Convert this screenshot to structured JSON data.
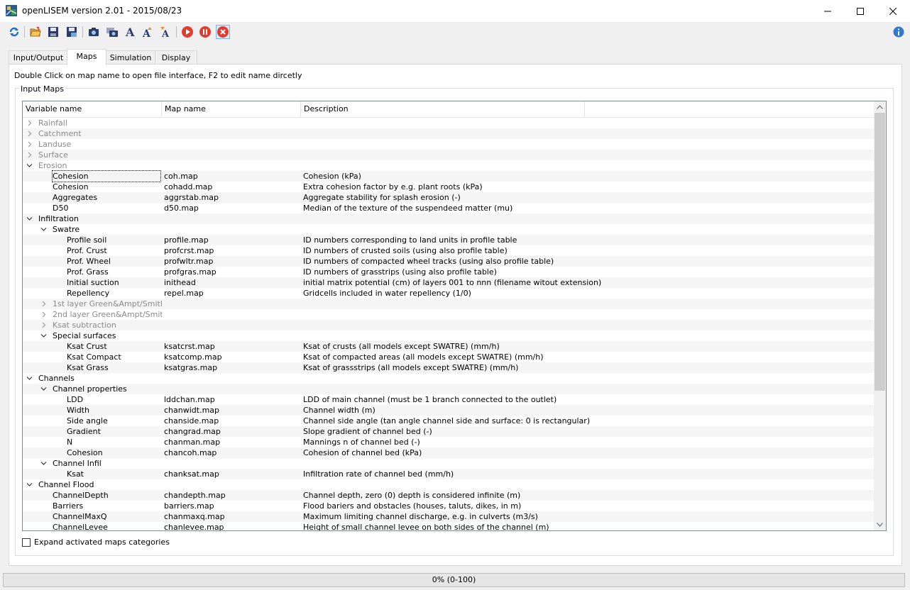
{
  "window": {
    "title": "openLISEM version 2.01 - 2015/08/23"
  },
  "toolbar": {
    "buttons": [
      "reload-icon",
      "open-folder-icon",
      "save-icon",
      "save-as-icon",
      "camera-icon",
      "camera-multi-icon",
      "font-icon",
      "font-increase-icon",
      "font-decrease-icon",
      "run-icon",
      "pause-icon",
      "stop-icon"
    ],
    "info_icon": "info-icon"
  },
  "tabs": [
    {
      "label": "Input/Output",
      "active": false
    },
    {
      "label": "Maps",
      "active": true
    },
    {
      "label": "Simulation",
      "active": false
    },
    {
      "label": "Display",
      "active": false
    }
  ],
  "hint": "Double Click on map name to open file interface, F2 to edit name dircetly",
  "group_title": "Input Maps",
  "columns": [
    "Variable name",
    "Map name",
    "Description"
  ],
  "rows": [
    {
      "level": 0,
      "expand": "collapsed",
      "name": "Rainfall",
      "map": "",
      "desc": "",
      "gray": true
    },
    {
      "level": 0,
      "expand": "collapsed",
      "name": "Catchment",
      "map": "",
      "desc": "",
      "gray": true
    },
    {
      "level": 0,
      "expand": "collapsed",
      "name": "Landuse",
      "map": "",
      "desc": "",
      "gray": true
    },
    {
      "level": 0,
      "expand": "collapsed",
      "name": "Surface",
      "map": "",
      "desc": "",
      "gray": true
    },
    {
      "level": 0,
      "expand": "expanded",
      "name": "Erosion",
      "map": "",
      "desc": "",
      "gray": true
    },
    {
      "level": 1,
      "expand": "none",
      "name": "Cohesion",
      "map": "coh.map",
      "desc": "Cohesion (kPa)",
      "focused": true
    },
    {
      "level": 1,
      "expand": "none",
      "name": "Cohesion",
      "map": "cohadd.map",
      "desc": "Extra cohesion factor by e.g. plant roots (kPa)"
    },
    {
      "level": 1,
      "expand": "none",
      "name": "Aggregates",
      "map": "aggrstab.map",
      "desc": "Aggregate stability for splash erosion (-)"
    },
    {
      "level": 1,
      "expand": "none",
      "name": "D50",
      "map": "d50.map",
      "desc": "Median of the texture of the suspendeed matter (mu)"
    },
    {
      "level": 0,
      "expand": "expanded",
      "name": "Infiltration",
      "map": "",
      "desc": ""
    },
    {
      "level": 1,
      "expand": "expanded",
      "name": "Swatre",
      "map": "",
      "desc": ""
    },
    {
      "level": 2,
      "expand": "none",
      "name": "Profile soil",
      "map": "profile.map",
      "desc": "ID numbers corresponding to land units in profile table"
    },
    {
      "level": 2,
      "expand": "none",
      "name": "Prof. Crust",
      "map": "profcrst.map",
      "desc": "ID numbers of crusted soils (using also profile table)"
    },
    {
      "level": 2,
      "expand": "none",
      "name": "Prof. Wheel",
      "map": "profwltr.map",
      "desc": "ID numbers of compacted wheel tracks (using also profile table)"
    },
    {
      "level": 2,
      "expand": "none",
      "name": "Prof. Grass",
      "map": "profgras.map",
      "desc": "ID numbers of grasstrips (using also profile table)"
    },
    {
      "level": 2,
      "expand": "none",
      "name": "Initial suction",
      "map": "inithead",
      "desc": "initial matrix potential (cm) of layers 001 to nnn (filename witout extension)"
    },
    {
      "level": 2,
      "expand": "none",
      "name": "Repellency",
      "map": "repel.map",
      "desc": "Gridcells included in water repellency (1/0)"
    },
    {
      "level": 1,
      "expand": "collapsed",
      "name": "1st layer Green&Ampt/Smith...",
      "map": "",
      "desc": "",
      "gray": true
    },
    {
      "level": 1,
      "expand": "collapsed",
      "name": "2nd layer Green&Ampt/Smith...",
      "map": "",
      "desc": "",
      "gray": true
    },
    {
      "level": 1,
      "expand": "collapsed",
      "name": "Ksat subtraction",
      "map": "",
      "desc": "",
      "gray": true
    },
    {
      "level": 1,
      "expand": "expanded",
      "name": "Special surfaces",
      "map": "",
      "desc": ""
    },
    {
      "level": 2,
      "expand": "none",
      "name": "Ksat Crust",
      "map": "ksatcrst.map",
      "desc": "Ksat of crusts (all models except SWATRE) (mm/h)"
    },
    {
      "level": 2,
      "expand": "none",
      "name": "Ksat Compact",
      "map": "ksatcomp.map",
      "desc": "Ksat of compacted areas (all models except SWATRE) (mm/h)"
    },
    {
      "level": 2,
      "expand": "none",
      "name": "Ksat Grass",
      "map": "ksatgras.map",
      "desc": "Ksat of grassstrips (all models except SWATRE) (mm/h)"
    },
    {
      "level": 0,
      "expand": "expanded",
      "name": "Channels",
      "map": "",
      "desc": ""
    },
    {
      "level": 1,
      "expand": "expanded",
      "name": "Channel properties",
      "map": "",
      "desc": ""
    },
    {
      "level": 2,
      "expand": "none",
      "name": "LDD",
      "map": "lddchan.map",
      "desc": "LDD of main channel (must be 1 branch connected to the outlet)"
    },
    {
      "level": 2,
      "expand": "none",
      "name": "Width",
      "map": "chanwidt.map",
      "desc": "Channel width (m)"
    },
    {
      "level": 2,
      "expand": "none",
      "name": "Side angle",
      "map": "chanside.map",
      "desc": "Channel side angle (tan angle  channel side and surface: 0 is rectangular)"
    },
    {
      "level": 2,
      "expand": "none",
      "name": "Gradient",
      "map": "changrad.map",
      "desc": "Slope gradient of channel bed (-)"
    },
    {
      "level": 2,
      "expand": "none",
      "name": "N",
      "map": "chanman.map",
      "desc": "Mannings n of channel bed (-)"
    },
    {
      "level": 2,
      "expand": "none",
      "name": "Cohesion",
      "map": "chancoh.map",
      "desc": "Cohesion of channel bed (kPa)"
    },
    {
      "level": 1,
      "expand": "expanded",
      "name": "Channel Infil",
      "map": "",
      "desc": ""
    },
    {
      "level": 2,
      "expand": "none",
      "name": "Ksat",
      "map": "chanksat.map",
      "desc": "Infiltration rate of channel bed (mm/h)"
    },
    {
      "level": 0,
      "expand": "expanded",
      "name": "Channel Flood",
      "map": "",
      "desc": ""
    },
    {
      "level": 1,
      "expand": "none",
      "name": "ChannelDepth",
      "map": "chandepth.map",
      "desc": "Channel depth, zero (0) depth is considered infinite (m)"
    },
    {
      "level": 1,
      "expand": "none",
      "name": "Barriers",
      "map": "barriers.map",
      "desc": "Flood bariers and obstacles (houses, taluts, dikes, in m)"
    },
    {
      "level": 1,
      "expand": "none",
      "name": "ChannelMaxQ",
      "map": "chanmaxq.map",
      "desc": "Maximum limiting channel discharge, e.g. in culverts (m3/s)"
    },
    {
      "level": 1,
      "expand": "none",
      "name": "ChannelLevee",
      "map": "chanlevee.map",
      "desc": "Height of small channel levee on both sides of the channel (m)"
    }
  ],
  "checkbox": {
    "label": "Expand activated maps categories",
    "checked": false
  },
  "status": {
    "text": "0% (0-100)",
    "progress": 0
  }
}
